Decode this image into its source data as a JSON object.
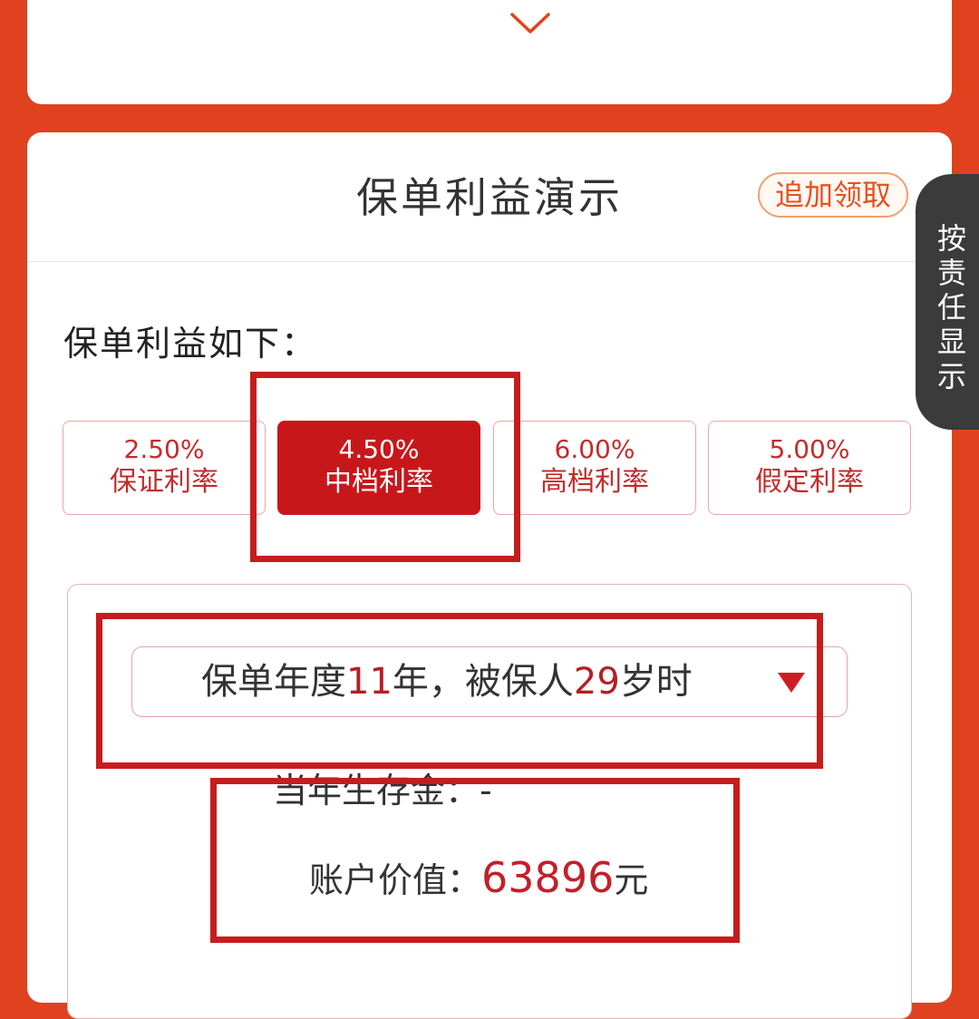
{
  "top_card": {
    "chevron_icon": "chevron-down-icon"
  },
  "card": {
    "title": "保单利益演示",
    "extra_claim_label": "追加领取",
    "section_heading": "保单利益如下："
  },
  "rate_options": [
    {
      "rate": "2.50%",
      "label": "保证利率",
      "selected": false
    },
    {
      "rate": "4.50%",
      "label": "中档利率",
      "selected": true
    },
    {
      "rate": "6.00%",
      "label": "高档利率",
      "selected": false
    },
    {
      "rate": "5.00%",
      "label": "假定利率",
      "selected": false
    }
  ],
  "detail": {
    "year_select": {
      "prefix": "保单年度",
      "policy_year": "11",
      "middle": "年，被保人",
      "insured_age": "29",
      "suffix": "岁时",
      "caret_icon": "dropdown-caret-icon"
    },
    "survival_label": "当年生存金：",
    "survival_value": "-",
    "account_label": "账户价值：",
    "account_value": "63896",
    "account_unit": "元"
  },
  "side_tab": {
    "label": "按责任显示"
  },
  "colors": {
    "background": "#e0421f",
    "primary_red": "#c8171b",
    "accent_orange": "#e5521f",
    "annotation_red": "#c51d1d",
    "side_tab": "#3b3b3b"
  }
}
